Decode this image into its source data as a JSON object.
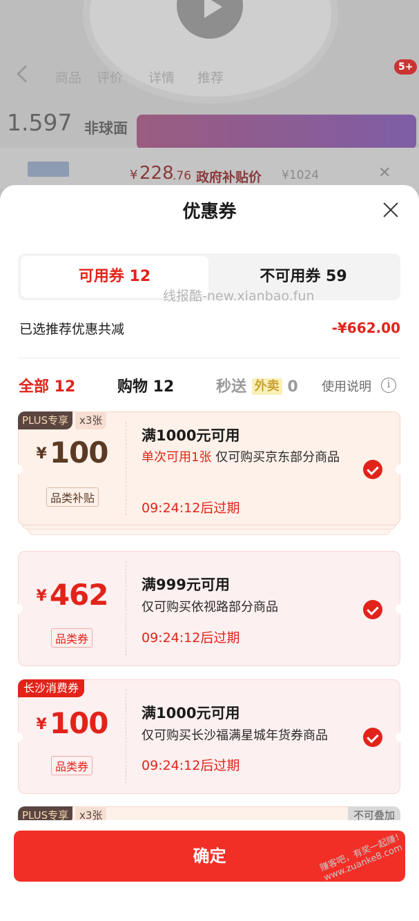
{
  "background": {
    "nav_items": [
      "商品",
      "评价",
      "详情",
      "推荐"
    ],
    "cart_badge": "5+",
    "price_value": "1.597",
    "price_unit": "非球面",
    "subsidy_price_yen": "¥",
    "subsidy_price_int": "228",
    "subsidy_price_dec": ".76",
    "subsidy_label": "政府补贴价",
    "original_price": "¥1024"
  },
  "sheet": {
    "title": "优惠券",
    "tabs": {
      "available": "可用券 12",
      "unavailable": "不可用券 59"
    },
    "watermark": "线报酷-new.xianbao.fun",
    "summary_label": "已选推荐优惠共减",
    "summary_value": "-¥662.00",
    "filters": {
      "all": "全部 12",
      "shopping": "购物 12",
      "flash_prefix": "秒送",
      "flash_tag": "外卖",
      "flash_count": "0",
      "usage": "使用说明",
      "info_glyph": "i"
    },
    "coupons": [
      {
        "badge": "PLUS专享",
        "count_badge": "x3张",
        "yen": "¥",
        "amount": "100",
        "category": "品类补贴",
        "title": "满1000元可用",
        "limit": "单次可用1张",
        "desc": "仅可购买京东部分商品",
        "expire": "09:24:12后过期",
        "selected": true
      },
      {
        "yen": "¥",
        "amount": "462",
        "category": "品类券",
        "title": "满999元可用",
        "desc": "仅可购买依视路部分商品",
        "expire": "09:24:12后过期",
        "selected": true
      },
      {
        "badge": "长沙消费券",
        "yen": "¥",
        "amount": "100",
        "category": "品类券",
        "title": "满1000元可用",
        "desc": "仅可购买长沙福满星城年货券商品",
        "expire": "09:24:12后过期",
        "selected": true
      },
      {
        "badge": "PLUS专享",
        "count_badge": "x3张",
        "stack_badge": "不可叠加"
      }
    ],
    "confirm_label": "确定"
  },
  "corner_watermark": "赚客吧，有奖一起赚！www.zuanke8.com",
  "colors": {
    "accent": "#e2231a",
    "plus_badge": "#5a4540",
    "coupon_bg": "#fef1ea"
  }
}
